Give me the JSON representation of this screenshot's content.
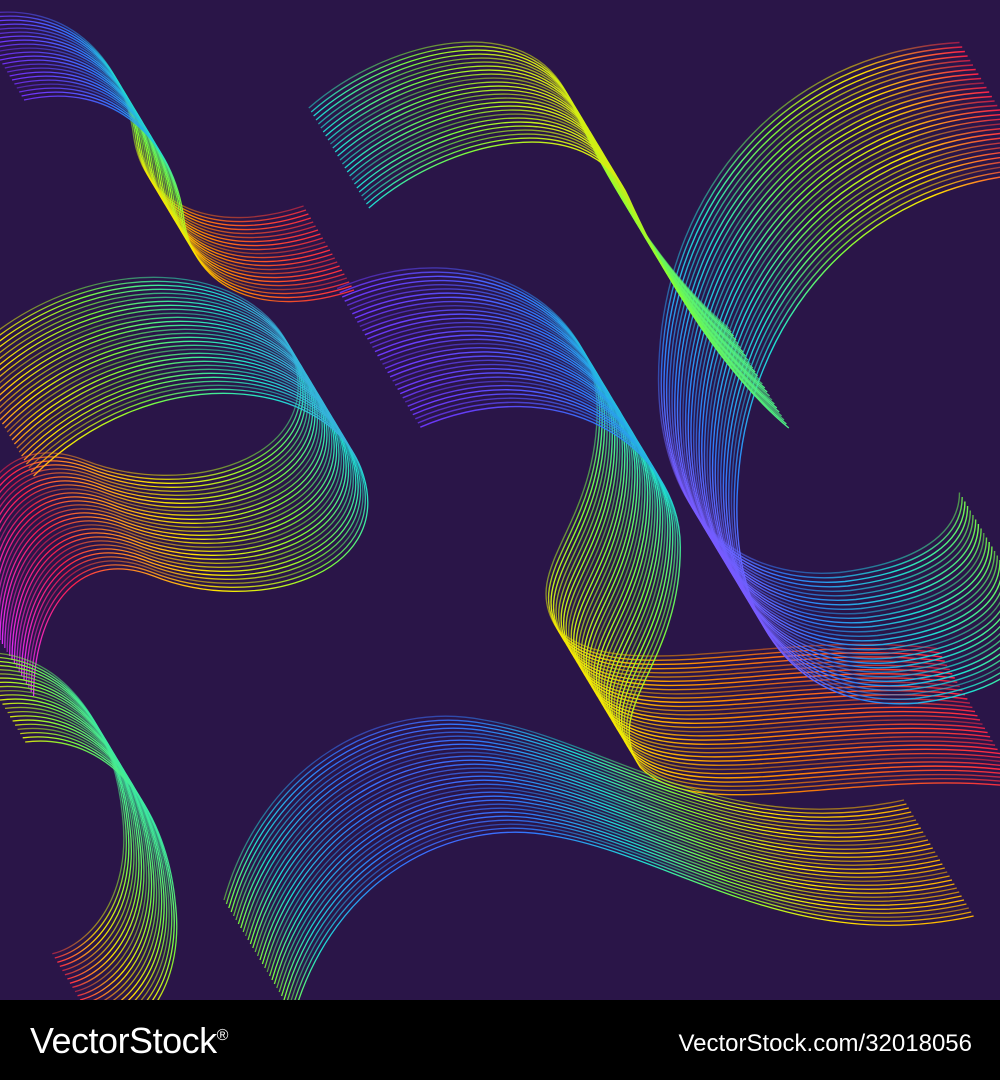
{
  "artwork": {
    "background_color": "#2a1548",
    "style": "iridescent neon marbled line pattern",
    "palette": [
      "#ff1f4b",
      "#ff8a00",
      "#ffe600",
      "#7dff3a",
      "#1fe0d0",
      "#2f7bff",
      "#7a2cff",
      "#e02cff"
    ]
  },
  "footer": {
    "background_color": "#000000",
    "brand": "VectorStock",
    "brand_mark": "®",
    "credit": "VectorStock.com/32018056"
  }
}
